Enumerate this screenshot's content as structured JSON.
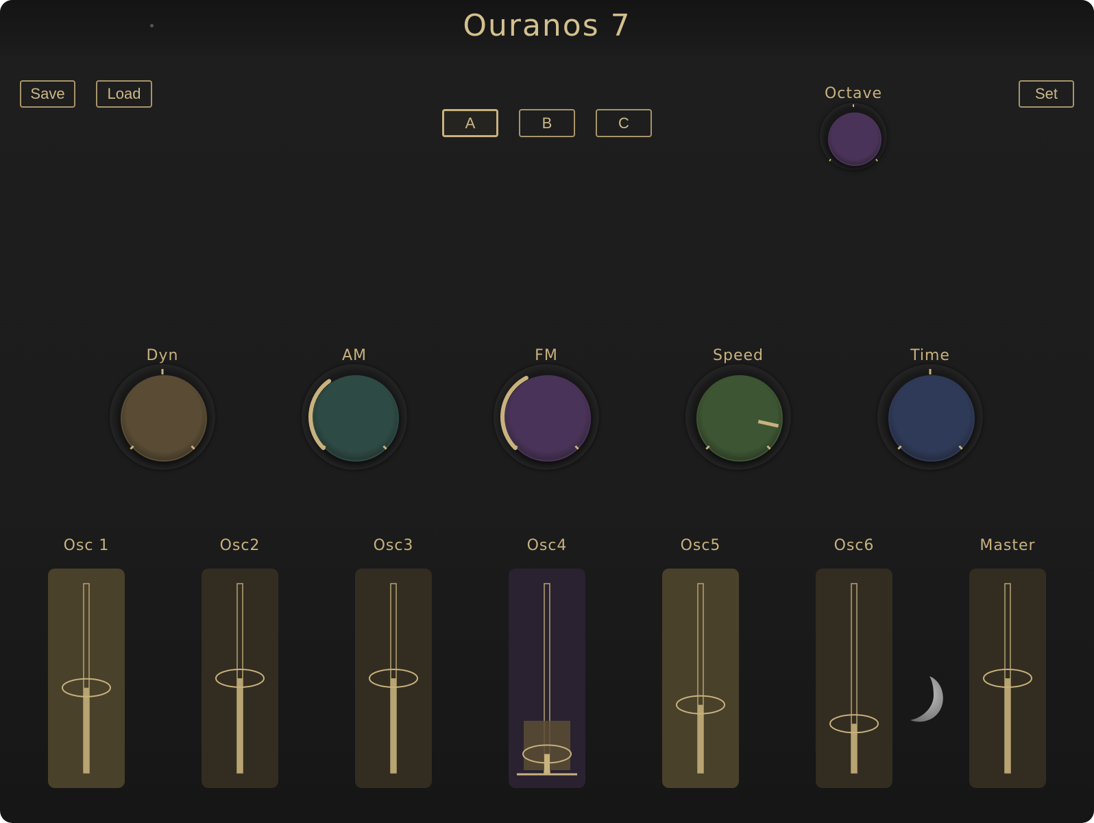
{
  "app": {
    "title": "Ouranos 7"
  },
  "toolbar": {
    "save_label": "Save",
    "load_label": "Load",
    "set_label": "Set"
  },
  "presets": [
    {
      "label": "A",
      "active": true
    },
    {
      "label": "B",
      "active": false
    },
    {
      "label": "C",
      "active": false
    }
  ],
  "octave": {
    "label": "Octave",
    "color": "#4a3358"
  },
  "knobs": [
    {
      "label": "Dyn",
      "color": "#5a4c34",
      "value": 0.5,
      "indicator": "top-tick"
    },
    {
      "label": "AM",
      "color": "#2e4a44",
      "value": 0.37,
      "indicator": "arc"
    },
    {
      "label": "FM",
      "color": "#4a3358",
      "value": 0.4,
      "indicator": "arc"
    },
    {
      "label": "Speed",
      "color": "#3d5532",
      "value": 0.88,
      "indicator": "line"
    },
    {
      "label": "Time",
      "color": "#2f3a58",
      "value": 0.5,
      "indicator": "top-tick"
    }
  ],
  "faders": [
    {
      "label": "Osc 1",
      "value": 0.45,
      "panel": "#4a412a"
    },
    {
      "label": "Osc2",
      "value": 0.5,
      "panel": "#332d21"
    },
    {
      "label": "Osc3",
      "value": 0.5,
      "panel": "#332d21"
    },
    {
      "label": "Osc4",
      "value": 0.1,
      "panel": "#2a2230"
    },
    {
      "label": "Osc5",
      "value": 0.36,
      "panel": "#4a412a"
    },
    {
      "label": "Osc6",
      "value": 0.26,
      "panel": "#332d21"
    },
    {
      "label": "Master",
      "value": 0.5,
      "panel": "#332d21"
    }
  ],
  "colors": {
    "accent": "#c8b27e",
    "background": "#1c1c1c"
  }
}
